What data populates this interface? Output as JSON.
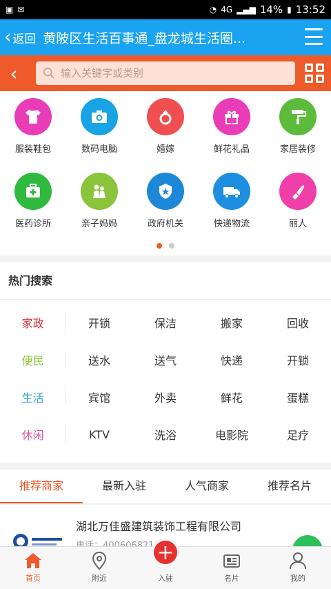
{
  "status_bar": {
    "battery": "14%",
    "time": "13:52",
    "network": "4G"
  },
  "header": {
    "back_label": "返回",
    "title": "黄陂区生活百事通_盘龙城生活圈..."
  },
  "search": {
    "placeholder": "输入关键字或类别"
  },
  "categories": [
    {
      "label": "服装鞋包",
      "icon": "tshirt-icon",
      "color": "#e93db8"
    },
    {
      "label": "数码电脑",
      "icon": "camera-icon",
      "color": "#18a4e4"
    },
    {
      "label": "婚嫁",
      "icon": "ring-icon",
      "color": "#ef4f4f"
    },
    {
      "label": "鲜花礼品",
      "icon": "gift-icon",
      "color": "#e93db8"
    },
    {
      "label": "家居装修",
      "icon": "paint-roller-icon",
      "color": "#5cbb3a"
    },
    {
      "label": "医药诊所",
      "icon": "medical-kit-icon",
      "color": "#2fb93f"
    },
    {
      "label": "亲子妈妈",
      "icon": "parent-child-icon",
      "color": "#8ac43a"
    },
    {
      "label": "政府机关",
      "icon": "police-badge-icon",
      "color": "#1e88d8"
    },
    {
      "label": "快递物流",
      "icon": "truck-icon",
      "color": "#1e8fe0"
    },
    {
      "label": "丽人",
      "icon": "lipstick-icon",
      "color": "#f03fa8"
    }
  ],
  "hot_search": {
    "title": "热门搜索",
    "rows": [
      {
        "category": "家政",
        "color": "#d9303a",
        "items": [
          "开锁",
          "保洁",
          "搬家",
          "回收"
        ]
      },
      {
        "category": "便民",
        "color": "#8cc63f",
        "items": [
          "送水",
          "送气",
          "快递",
          "开锁"
        ]
      },
      {
        "category": "生活",
        "color": "#2aa6c9",
        "items": [
          "宾馆",
          "外卖",
          "鲜花",
          "蛋糕"
        ]
      },
      {
        "category": "休闲",
        "color": "#d65aa7",
        "items": [
          "KTV",
          "洗浴",
          "电影院",
          "足疗"
        ]
      }
    ]
  },
  "tabs": [
    {
      "label": "推荐商家"
    },
    {
      "label": "最新入驻"
    },
    {
      "label": "人气商家"
    },
    {
      "label": "推荐名片"
    }
  ],
  "merchant": {
    "name": "湖北万佳盛建筑装饰工程有限公司",
    "phone": "电话：400606821"
  },
  "bottom_nav": [
    {
      "label": "首页",
      "icon": "home-icon"
    },
    {
      "label": "附近",
      "icon": "location-pin-icon"
    },
    {
      "label": "入驻",
      "icon": "plus-icon"
    },
    {
      "label": "名片",
      "icon": "business-card-icon"
    },
    {
      "label": "我的",
      "icon": "user-icon"
    }
  ],
  "colors": {
    "header_blue": "#1aa3f0",
    "accent_orange": "#ef5a2a"
  }
}
